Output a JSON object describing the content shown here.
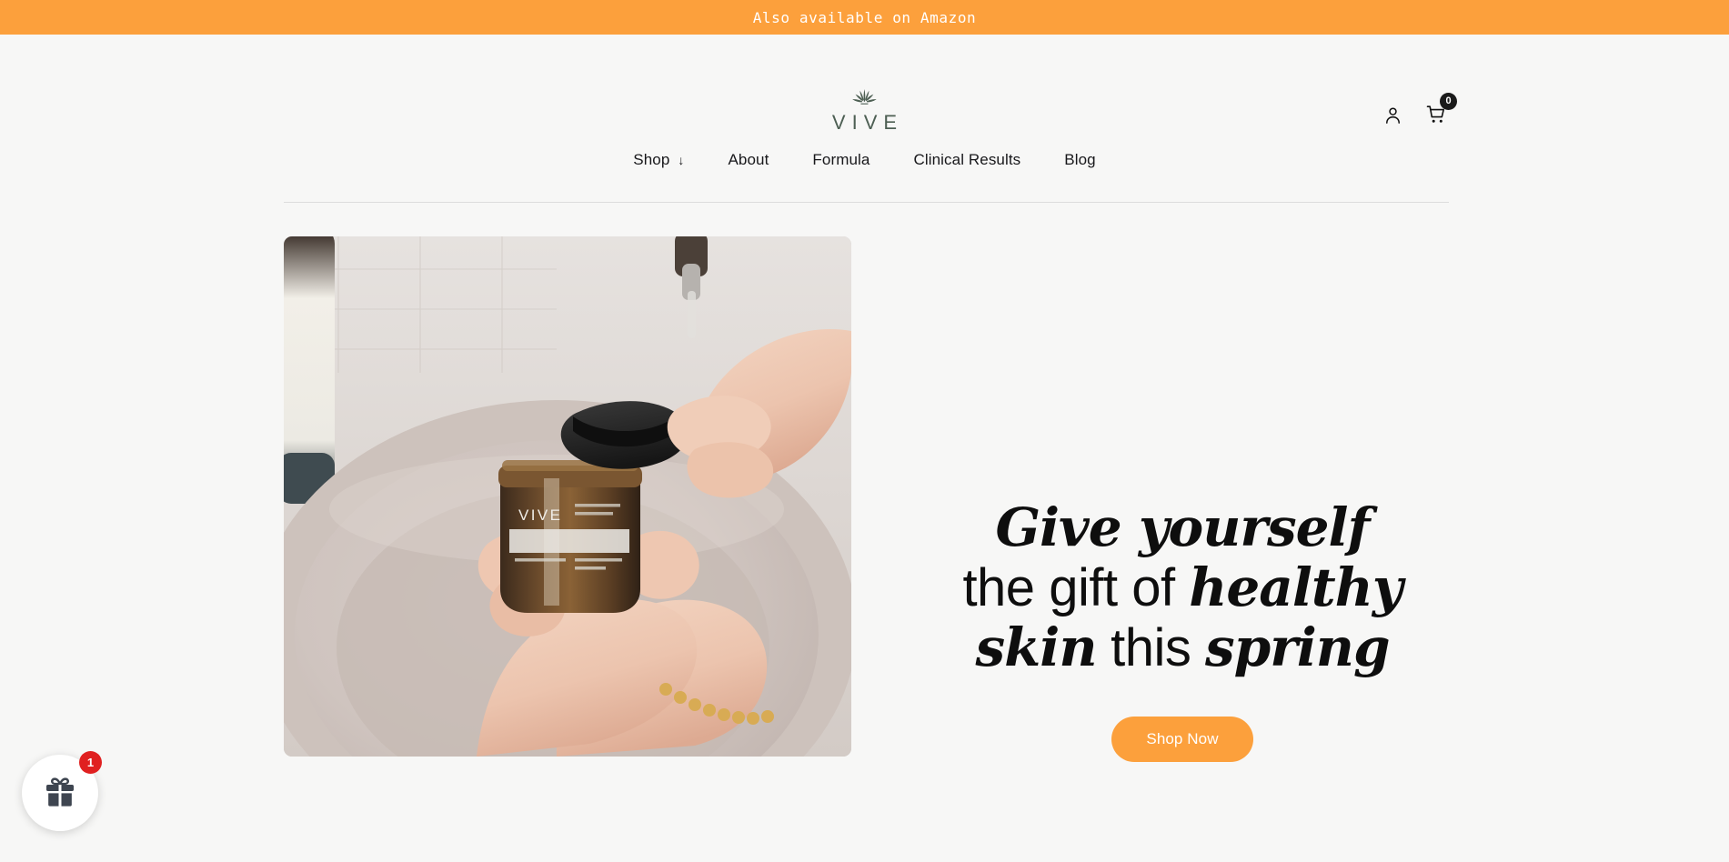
{
  "announcement": {
    "text": "Also available on Amazon"
  },
  "header": {
    "logo": {
      "wordmark": "VIVE",
      "icon": "hemp-leaf-icon",
      "color": "#4d5f53"
    },
    "account_icon": "person-icon",
    "cart_icon": "shopping-cart-icon",
    "cart_count": "0"
  },
  "nav": {
    "items": [
      {
        "label": "Shop",
        "caret": "↓",
        "has_caret": true
      },
      {
        "label": "About",
        "has_caret": false
      },
      {
        "label": "Formula",
        "has_caret": false
      },
      {
        "label": "Clinical Results",
        "has_caret": false
      },
      {
        "label": "Blog",
        "has_caret": false
      }
    ]
  },
  "hero": {
    "image_alt": "Hands holding an amber VIVE jar with black lid over a marble sink",
    "heading": {
      "line1_em": "Give yourself",
      "line1_rest": " the",
      "line2_rest": "gift of ",
      "line2_em": "healthy",
      "line3_em": "skin",
      "line3_rest": " this ",
      "line3_em2": "spring"
    },
    "cta_label": "Shop Now"
  },
  "gift_widget": {
    "icon": "gift-box-icon",
    "badge_count": "1",
    "badge_color": "#e02020"
  },
  "colors": {
    "accent_orange": "#fca03c",
    "page_background": "#f7f7f6",
    "text_dark": "#0e0e0e",
    "logo_green": "#4d5f53"
  }
}
